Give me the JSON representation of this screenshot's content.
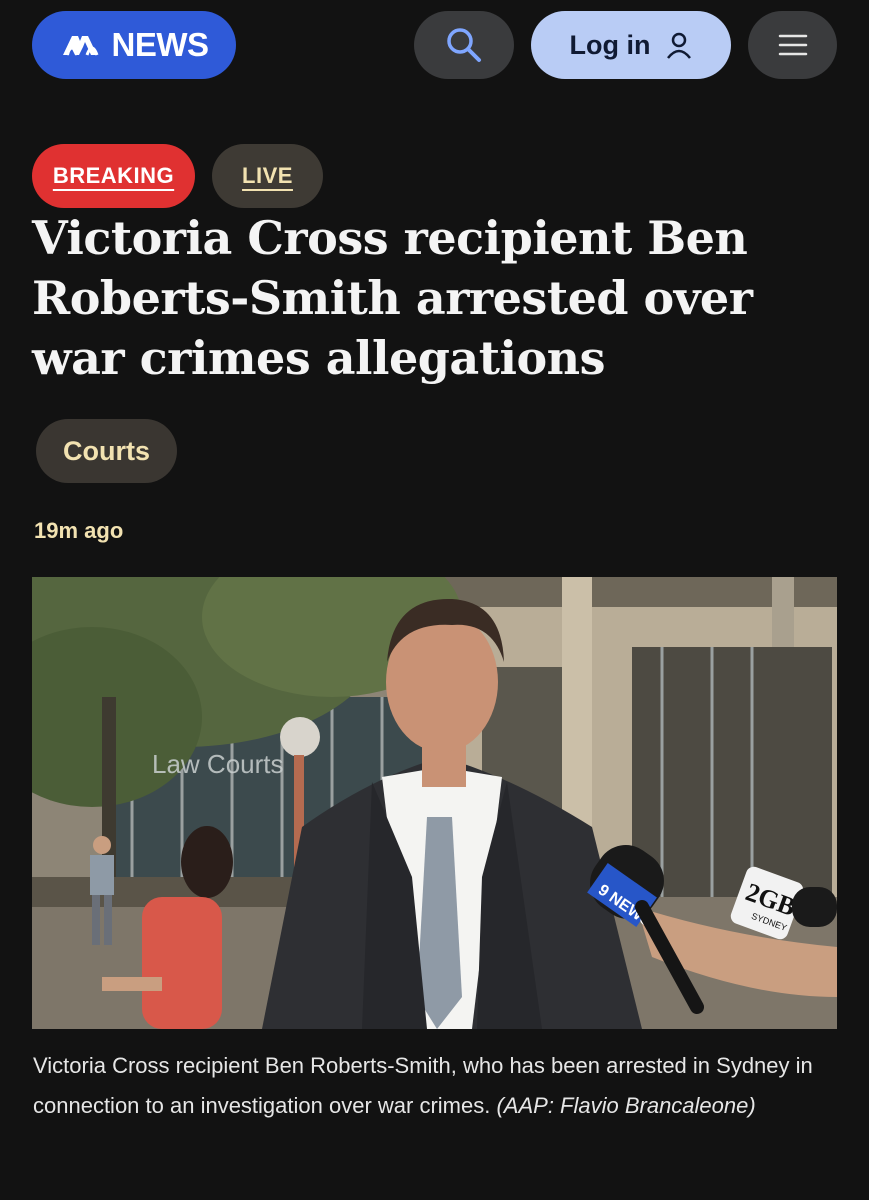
{
  "header": {
    "logo_text": "NEWS",
    "search_icon": "search-icon",
    "login_label": "Log in",
    "user_icon": "user-icon",
    "menu_icon": "hamburger-menu-icon"
  },
  "badges": {
    "breaking": "BREAKING",
    "live": "LIVE"
  },
  "article": {
    "headline": "Victoria Cross recipient Ben Roberts-Smith arrested over war crimes allegations",
    "topic": "Courts",
    "timestamp": "19m ago",
    "caption": "Victoria Cross recipient Ben Roberts-Smith, who has been arrested in Sydney in connection to an investigation over war crimes.",
    "credit": "(AAP: Flavio Brancaleone)"
  },
  "photo": {
    "sign_text": "Law Courts",
    "mic_label_1": "9 NEWS",
    "mic_label_2": "2GB",
    "mic_label_2_sub": "SYDNEY"
  },
  "colors": {
    "background": "#121212",
    "logo_blue": "#2f5ad8",
    "login_bg": "#b9ccf5",
    "breaking_red": "#e03131",
    "accent_cream": "#f2e2b1"
  }
}
